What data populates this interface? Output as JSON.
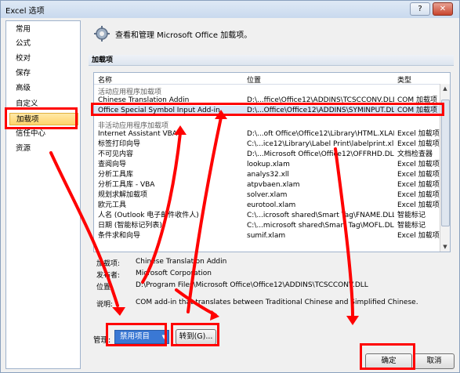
{
  "window": {
    "title": "Excel 选项",
    "help": "?",
    "close": "✕"
  },
  "sidebar": {
    "items": [
      {
        "label": "常用"
      },
      {
        "label": "公式"
      },
      {
        "label": "校对"
      },
      {
        "label": "保存"
      },
      {
        "label": "高级"
      },
      {
        "label": "自定义"
      },
      {
        "label": "加载项",
        "selected": true
      },
      {
        "label": "信任中心"
      },
      {
        "label": "资源"
      }
    ]
  },
  "header": {
    "text": "查看和管理 Microsoft Office 加载项。"
  },
  "section": {
    "label": "加载项"
  },
  "table": {
    "columns": [
      "名称",
      "位置",
      "类型"
    ],
    "active_group": "活动应用程序加载项",
    "inactive_group": "非活动应用程序加载项",
    "active_rows": [
      {
        "name": "Chinese Translation Addin",
        "location": "D:\\...ffice\\Office12\\ADDINS\\TCSCCONV.DLL",
        "type": "COM 加载项"
      },
      {
        "name": "Office Special Symbol Input Add-in",
        "location": "D:\\...Office\\Office12\\ADDINS\\SYMINPUT.DLL",
        "type": "COM 加载项"
      }
    ],
    "inactive_rows": [
      {
        "name": "Internet Assistant VBA",
        "location": "D:\\...oft Office\\Office12\\Library\\HTML.XLAM",
        "type": "Excel 加载项"
      },
      {
        "name": "标签打印向导",
        "location": "C:\\...ice12\\Library\\Label Print\\labelprint.xlam",
        "type": "Excel 加载项"
      },
      {
        "name": "不可见内容",
        "location": "D:\\...Microsoft Office\\Office12\\OFFRHD.DLL",
        "type": "文档检查器"
      },
      {
        "name": "查阅向导",
        "location": "lookup.xlam",
        "type": "Excel 加载项"
      },
      {
        "name": "分析工具库",
        "location": "analys32.xll",
        "type": "Excel 加载项"
      },
      {
        "name": "分析工具库 - VBA",
        "location": "atpvbaen.xlam",
        "type": "Excel 加载项"
      },
      {
        "name": "规划求解加载项",
        "location": "solver.xlam",
        "type": "Excel 加载项"
      },
      {
        "name": "欧元工具",
        "location": "eurotool.xlam",
        "type": "Excel 加载项"
      },
      {
        "name": "人名 (Outlook 电子邮件收件人)",
        "location": "C:\\...icrosoft shared\\Smart Tag\\FNAME.DLL",
        "type": "智能标记"
      },
      {
        "name": "日期 (智能标记列表)",
        "location": "C:\\...microsoft shared\\Smart Tag\\MOFL.DLL",
        "type": "智能标记"
      },
      {
        "name": "条件求和向导",
        "location": "sumif.xlam",
        "type": "Excel 加载项"
      }
    ]
  },
  "details": {
    "addin_label": "加载项:",
    "addin_value": "Chinese Translation Addin",
    "publisher_label": "发布者:",
    "publisher_value": "Microsoft Corporation",
    "location_label": "位置:",
    "location_value": "D:\\Program Files\\Microsoft Office\\Office12\\ADDINS\\TCSCCONV.DLL",
    "description_label": "说明:",
    "description_value": "COM add-in that translates between Traditional Chinese and Simplified Chinese."
  },
  "footer": {
    "manage_label": "管理:",
    "manage_selected": "禁用项目",
    "goto_label": "转到(G)...",
    "ok_label": "确定",
    "cancel_label": "取消"
  },
  "colors": {
    "annotation": "#ff0000",
    "selection": "#3a78d4"
  }
}
